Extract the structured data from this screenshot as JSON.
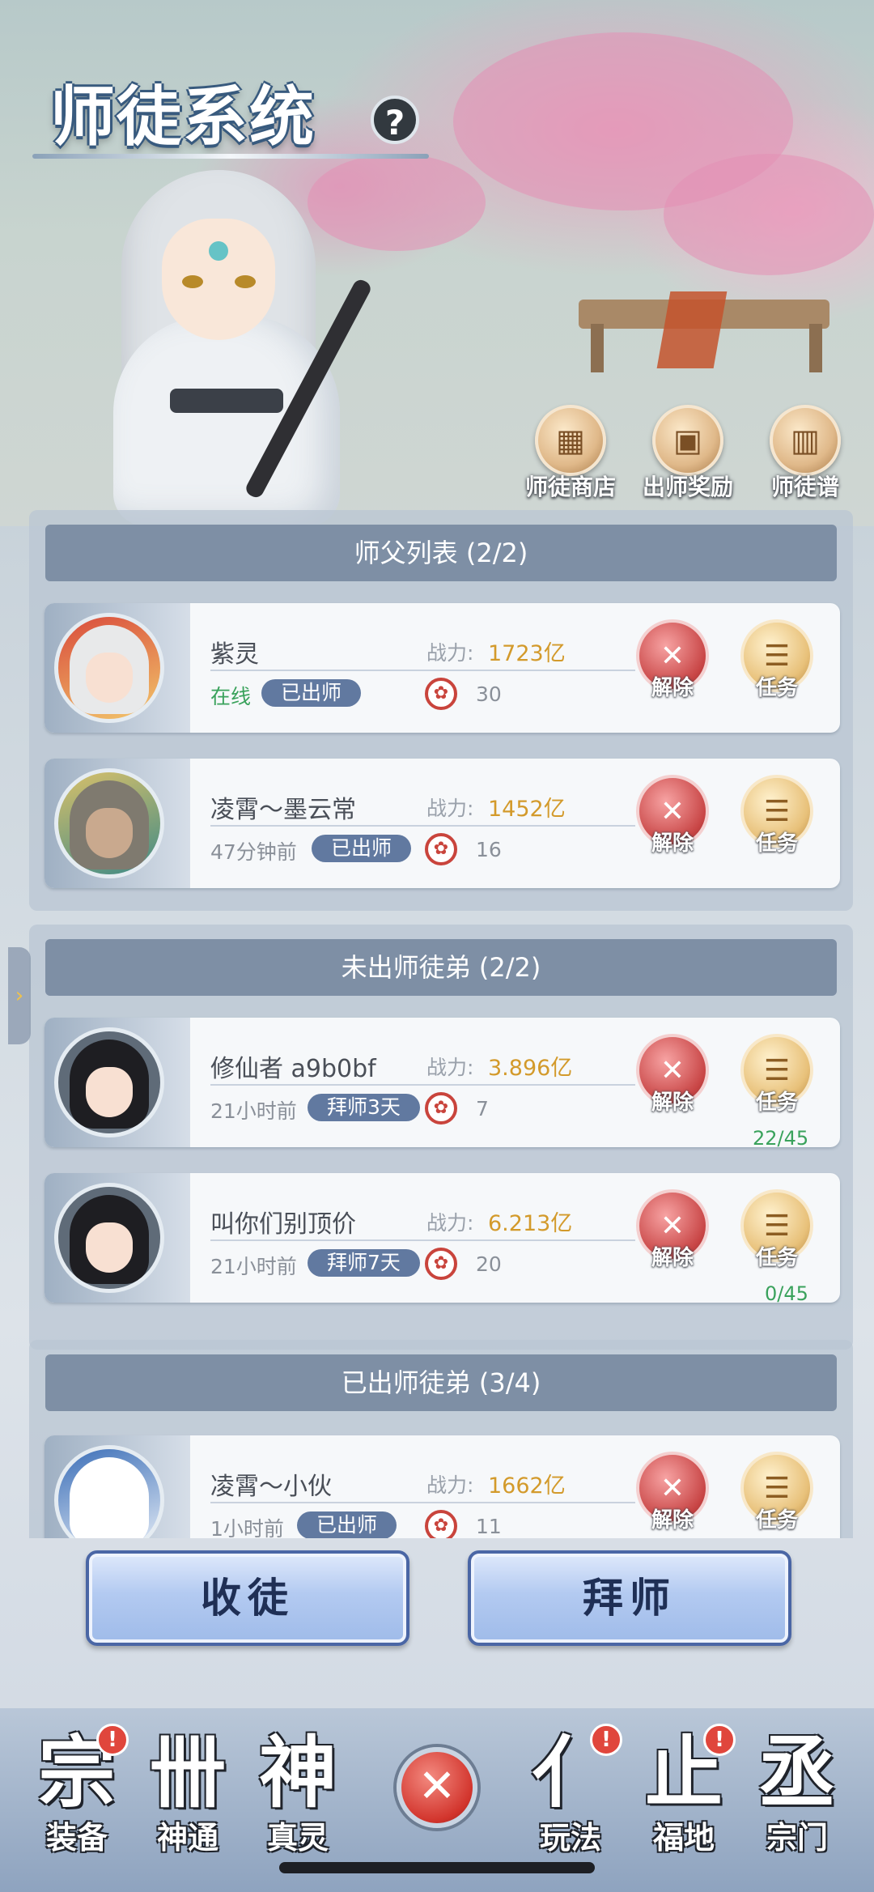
{
  "header": {
    "title": "师徒系统",
    "help": "?",
    "shortcuts": [
      {
        "label": "师徒商店",
        "icon": "shop-icon"
      },
      {
        "label": "出师奖励",
        "icon": "gift-icon"
      },
      {
        "label": "师徒谱",
        "icon": "book-icon"
      }
    ]
  },
  "master_list": {
    "header": "师父列表 (2/2)",
    "items": [
      {
        "name": "紫灵",
        "status": "在线",
        "tag": "已出师",
        "power_label": "战力:",
        "power": "1723亿",
        "intimacy": "30",
        "remove": "解除",
        "task": "任务",
        "progress": ""
      },
      {
        "name": "凌霄～墨云常",
        "status": "47分钟前",
        "tag": "已出师",
        "power_label": "战力:",
        "power": "1452亿",
        "intimacy": "16",
        "remove": "解除",
        "task": "任务",
        "progress": ""
      }
    ]
  },
  "apprentice_list": {
    "header": "未出师徒弟 (2/2)",
    "items": [
      {
        "name": "修仙者 a9b0bf",
        "status": "21小时前",
        "tag": "拜师3天",
        "power_label": "战力:",
        "power": "3.896亿",
        "intimacy": "7",
        "remove": "解除",
        "task": "任务",
        "progress": "22/45"
      },
      {
        "name": "叫你们别顶价",
        "status": "21小时前",
        "tag": "拜师7天",
        "power_label": "战力:",
        "power": "6.213亿",
        "intimacy": "20",
        "remove": "解除",
        "task": "任务",
        "progress": "0/45"
      }
    ]
  },
  "graduated_list": {
    "header": "已出师徒弟 (3/4)",
    "items": [
      {
        "name": "凌霄～小伙",
        "status": "1小时前",
        "tag": "已出师",
        "power_label": "战力:",
        "power": "1662亿",
        "intimacy": "11",
        "remove": "解除",
        "task": "任务",
        "progress": ""
      }
    ]
  },
  "actions": {
    "recruit": "收徒",
    "apprentice": "拜师"
  },
  "bottom_nav": {
    "items": [
      {
        "label": "装备",
        "glyph": "宗",
        "badge": "!"
      },
      {
        "label": "神通",
        "glyph": "卌",
        "badge": ""
      },
      {
        "label": "真灵",
        "glyph": "神",
        "badge": ""
      },
      {
        "label": "玩法",
        "glyph": "亻",
        "badge": "!"
      },
      {
        "label": "福地",
        "glyph": "止",
        "badge": "!"
      },
      {
        "label": "宗门",
        "glyph": "丞",
        "badge": ""
      }
    ],
    "close": "✕"
  },
  "colors": {
    "accent": "#6179a0",
    "online": "#3aa25c",
    "power": "#d39a2b",
    "danger": "#c84545"
  }
}
